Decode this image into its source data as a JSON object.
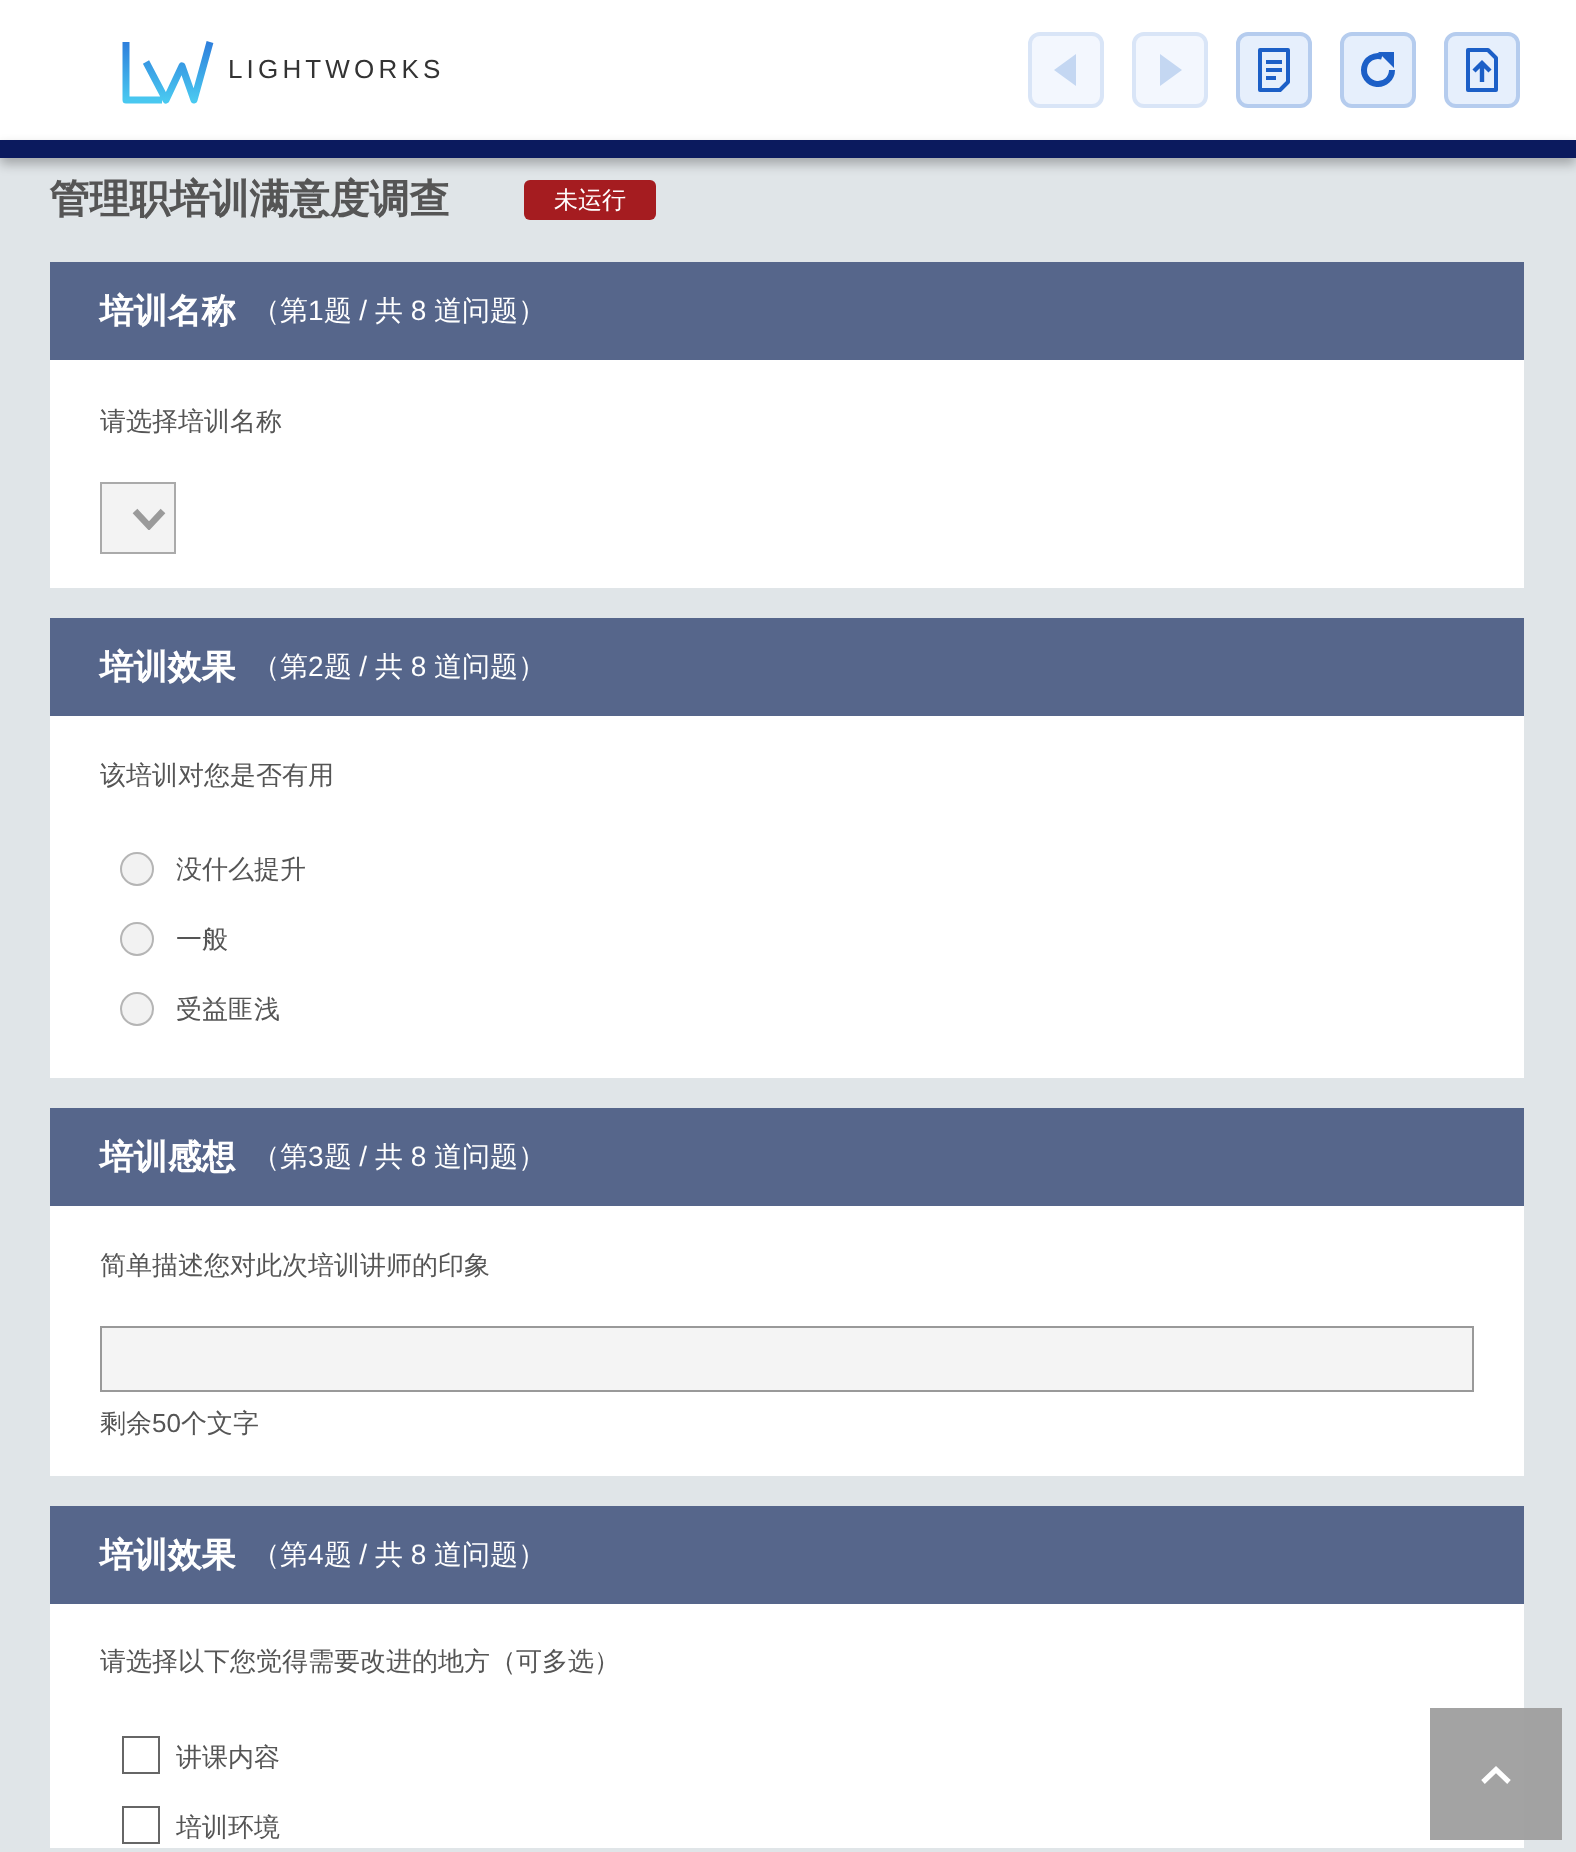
{
  "header": {
    "logo_text": "LIGHTWORKS",
    "toolbar": [
      {
        "kind": "previous",
        "disabled": true
      },
      {
        "kind": "next",
        "disabled": true
      },
      {
        "kind": "document",
        "disabled": false
      },
      {
        "kind": "refresh",
        "disabled": false
      },
      {
        "kind": "export",
        "disabled": false
      }
    ]
  },
  "survey": {
    "title": "管理职培训满意度调查",
    "status_badge": "未运行"
  },
  "questions": [
    {
      "kind": "select",
      "title": "培训名称",
      "counter": "（第1题 / 共 8 道问题）",
      "prompt": "请选择培训名称"
    },
    {
      "kind": "radio",
      "title": "培训效果",
      "counter": "（第2题 / 共 8 道问题）",
      "prompt": "该培训对您是否有用",
      "options": [
        {
          "label": "没什么提升",
          "selected": false
        },
        {
          "label": "一般",
          "selected": false
        },
        {
          "label": "受益匪浅",
          "selected": false
        }
      ]
    },
    {
      "kind": "text",
      "title": "培训感想",
      "counter": "（第3题 / 共 8 道问题）",
      "prompt": "简单描述您对此次培训讲师的印象",
      "char_counter": "剩余50个文字"
    },
    {
      "kind": "checkbox",
      "title": "培训效果",
      "counter": "（第4题 / 共 8 道问题）",
      "prompt": "请选择以下您觉得需要改进的地方（可多选）",
      "options": [
        {
          "label": "讲课内容",
          "checked": false
        },
        {
          "label": "培训环境",
          "checked": false
        }
      ]
    }
  ]
}
